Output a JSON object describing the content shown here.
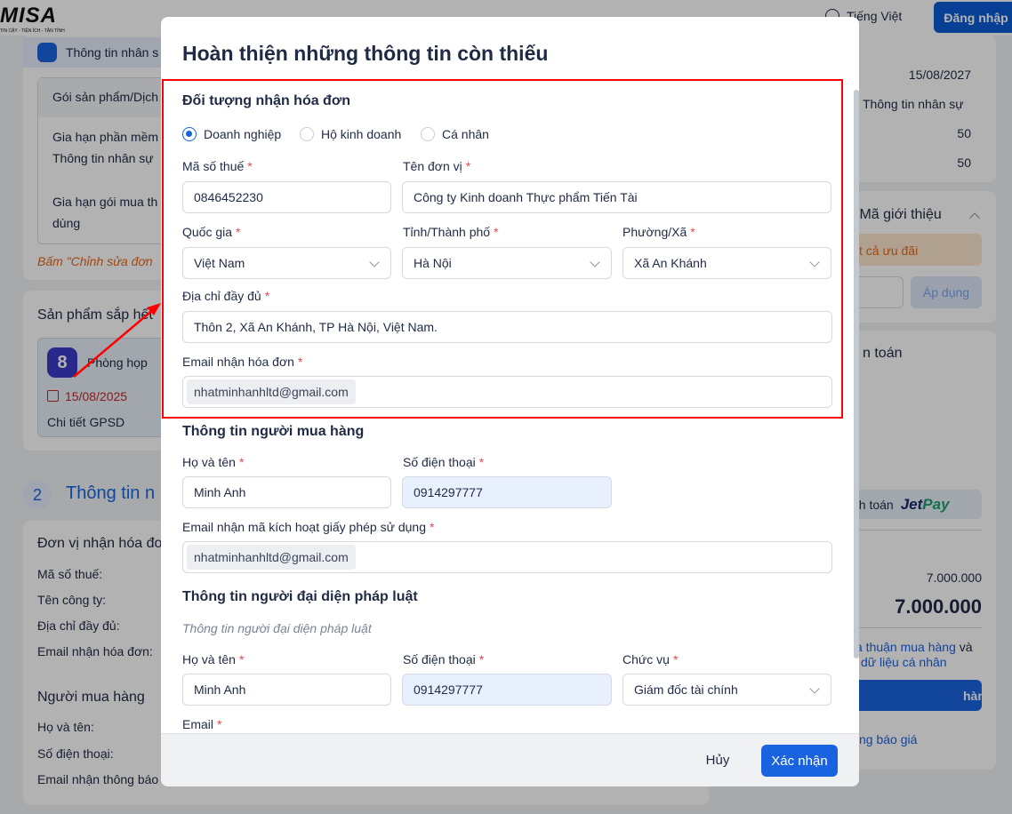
{
  "header": {
    "logo": "MISA",
    "logo_tagline": "TIN CẬY - TIỆN ÍCH - TẬN TÌNH",
    "language": "Tiếng Việt",
    "login": "Đăng nhập"
  },
  "background": {
    "card1": {
      "title": "Thông tin nhân s",
      "table_header": "Gói sản phẩm/Dịch",
      "row1_line1": "Gia hạn phần mềm",
      "row1_line2": "Thông tin nhân sự",
      "row2_line1": "Gia hạn gói mua th",
      "row2_line2": "dùng",
      "note": "Bấm \"Chỉnh sửa đơn"
    },
    "card2": {
      "title": "Sản phẩm sắp hết",
      "product": "Phòng họp",
      "date": "15/08/2025",
      "detail": "Chi tiết GPSD"
    },
    "section2": {
      "number": "2",
      "title": "Thông tin n"
    },
    "card3": {
      "title": "Đơn vị nhận hóa đơ",
      "labels": [
        "Mã số thuế:",
        "Tên công ty:",
        "Địa chỉ đầy đủ:",
        "Email nhận hóa đơn:"
      ],
      "buyer_title": "Người mua hàng",
      "buyer_labels": [
        "Họ và tên:",
        "Số điện thoại:",
        "Email nhận thông báo"
      ]
    },
    "right": {
      "date": "15/08/2027",
      "product": "Thông tin nhân sự",
      "qty1": "50",
      "qty2": "50",
      "promo_title": "/Mã giới thiệu",
      "promo_banner": "t cả ưu đãi",
      "apply": "Áp dụng",
      "pay_title": "n toán",
      "pay_method": "nh toán",
      "jet": "Jet",
      "pay": "Pay",
      "subtotal": "7.000.000",
      "total": "7.000.000",
      "terms_line1_link": "a thuận mua hàng",
      "terms_line1_and": " và",
      "terms_line2": "dữ liệu cá nhân",
      "order_button": "hàng",
      "quote_link": "ng báo giá"
    }
  },
  "modal": {
    "title": "Hoàn thiện những thông tin còn thiếu",
    "invoice": {
      "title": "Đối tượng nhận hóa đơn",
      "options": [
        "Doanh nghiệp",
        "Hộ kinh doanh",
        "Cá nhân"
      ],
      "selected": "Doanh nghiệp",
      "tax_label": "Mã số thuế",
      "tax_value": "0846452230",
      "unit_label": "Tên đơn vị",
      "unit_value": "Công ty Kinh doanh Thực phẩm Tiến Tài",
      "country_label": "Quốc gia",
      "country_value": "Việt Nam",
      "city_label": "Tỉnh/Thành phố",
      "city_value": "Hà Nội",
      "ward_label": "Phường/Xã",
      "ward_value": "Xã An Khánh",
      "address_label": "Địa chỉ đầy đủ",
      "address_value": "Thôn 2, Xã An Khánh, TP Hà Nội, Việt Nam.",
      "email_label": "Email nhận hóa đơn",
      "email_value": "nhatminhanhltd@gmail.com"
    },
    "buyer": {
      "title": "Thông tin người mua hàng",
      "name_label": "Họ và tên",
      "name_value": "Minh Anh",
      "phone_label": "Số điện thoại",
      "phone_value": "0914297777",
      "email_label": "Email nhận mã kích hoạt giấy phép sử dụng",
      "email_value": "nhatminhanhltd@gmail.com"
    },
    "legal": {
      "title": "Thông tin người đại diện pháp luật",
      "subtitle": "Thông tin người đại diện pháp luật",
      "name_label": "Họ và tên",
      "name_value": "Minh Anh",
      "phone_label": "Số điện thoại",
      "phone_value": "0914297777",
      "position_label": "Chức vụ",
      "position_value": "Giám đốc tài chính",
      "email_label": "Email"
    },
    "required_mark": "*",
    "cancel": "Hủy",
    "confirm": "Xác nhận"
  },
  "colors": {
    "primary": "#1a63e0",
    "annotation": "#ff0000"
  }
}
